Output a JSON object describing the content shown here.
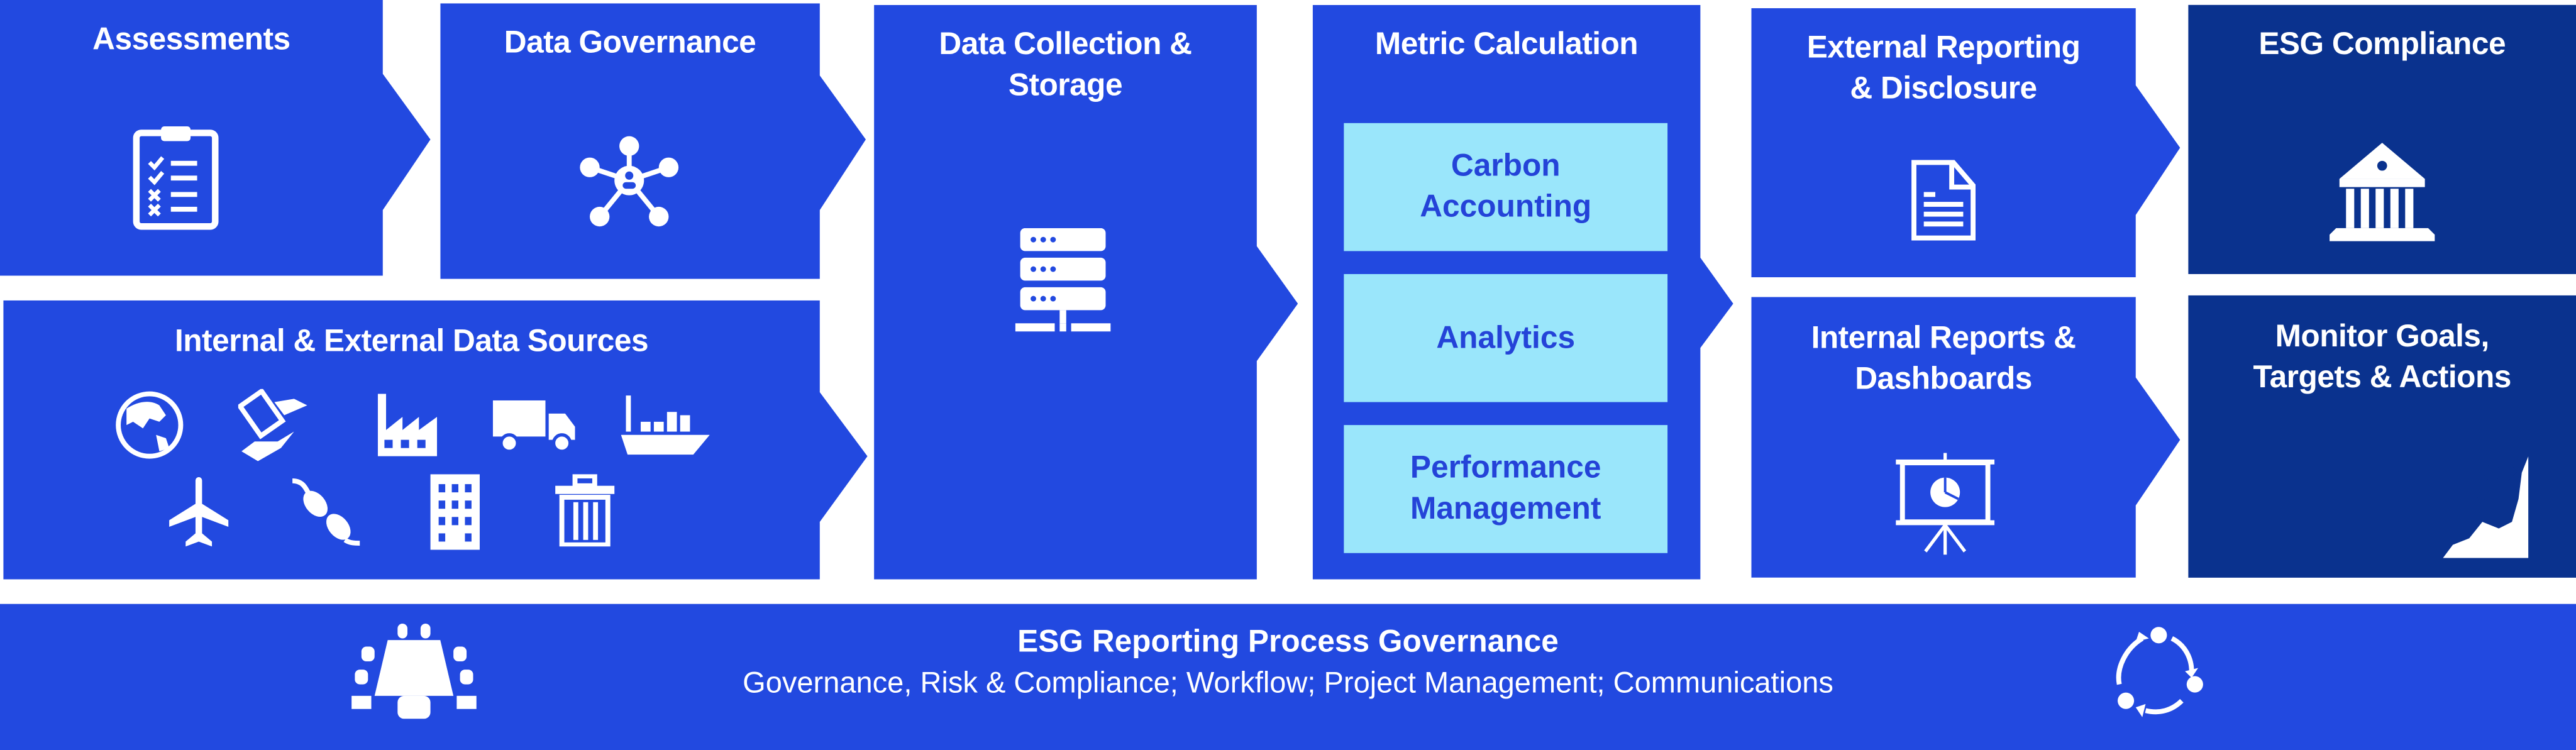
{
  "colors": {
    "primary_blue": "#2249e0",
    "dark_navy": "#0a328e",
    "light_cyan": "#9ae6fb",
    "cyan_text": "#2443d8",
    "white": "#ffffff"
  },
  "stages": {
    "assessments": {
      "title": "Assessments",
      "icon": "clipboard-checklist-icon"
    },
    "data_governance": {
      "title": "Data Governance",
      "icon": "network-user-icon"
    },
    "data_sources": {
      "title": "Internal & External Data Sources",
      "icons": [
        "globe-icon",
        "money-hand-icon",
        "factory-icon",
        "truck-icon",
        "ship-icon",
        "airplane-icon",
        "plug-icon",
        "building-icon",
        "trash-icon"
      ]
    },
    "data_collection": {
      "title_line1": "Data Collection &",
      "title_line2": "Storage",
      "icon": "server-icon"
    },
    "metric_calculation": {
      "title": "Metric Calculation",
      "items": [
        {
          "line1": "Carbon",
          "line2": "Accounting"
        },
        {
          "line1": "Analytics",
          "line2": ""
        },
        {
          "line1": "Performance",
          "line2": "Management"
        }
      ]
    },
    "external_reporting": {
      "title_line1": "External Reporting",
      "title_line2": "& Disclosure",
      "icon": "document-icon"
    },
    "internal_reports": {
      "title_line1": "Internal Reports &",
      "title_line2": "Dashboards",
      "icon": "presentation-chart-icon"
    },
    "esg_compliance": {
      "title": "ESG Compliance",
      "icon": "bank-building-icon"
    },
    "monitor_goals": {
      "title_line1": "Monitor Goals,",
      "title_line2": "Targets & Actions",
      "icon": "climber-icon"
    }
  },
  "footer": {
    "title": "ESG Reporting Process Governance",
    "subtitle": "Governance, Risk & Compliance; Workflow; Project Management; Communications",
    "left_icon": "conference-table-icon",
    "right_icon": "cycle-arrows-icon"
  }
}
